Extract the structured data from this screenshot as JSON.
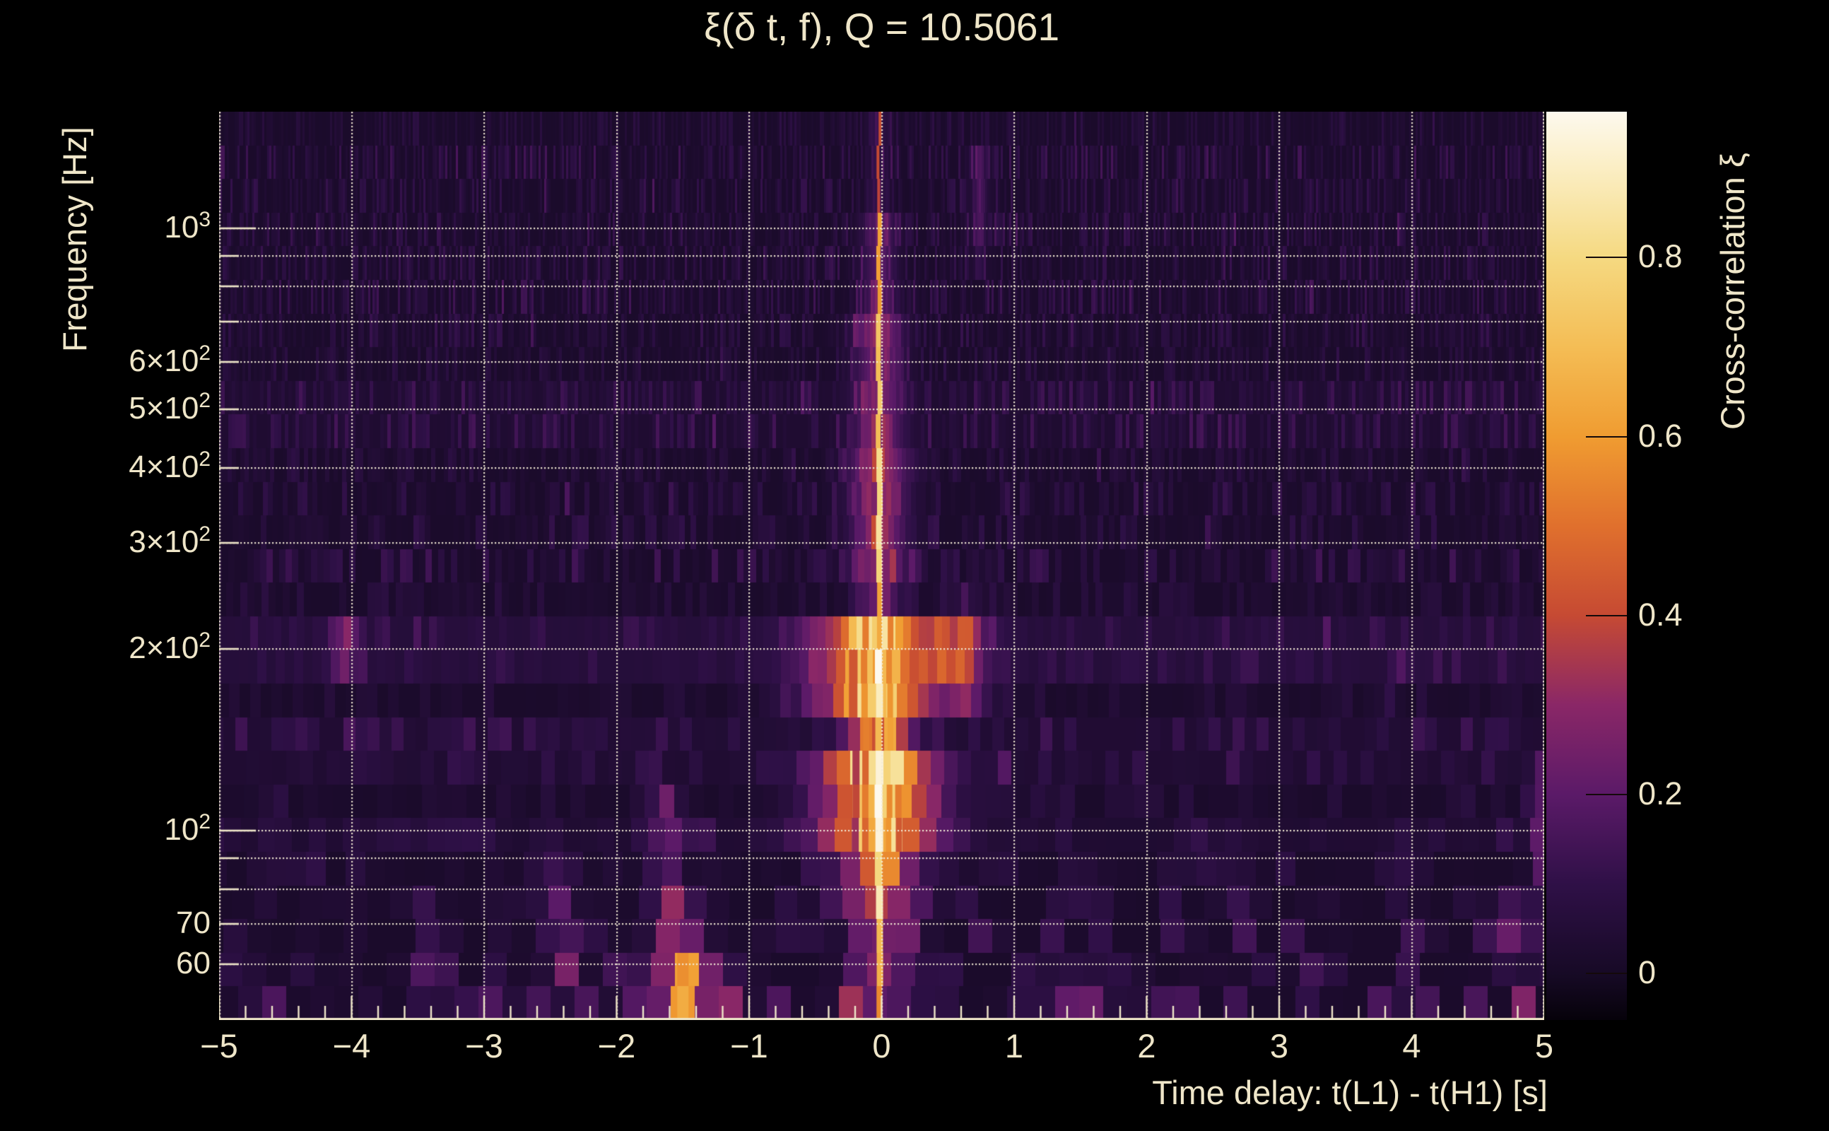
{
  "chart_data": {
    "type": "heatmap",
    "title": "ξ(δ t, f), Q = 10.5061",
    "xlabel": "Time delay: t(L1) - t(H1) [s]",
    "ylabel": "Frequency [Hz]",
    "colorbar_label": "Cross-correlation ξ",
    "x_range": [
      -5,
      5
    ],
    "x_ticks": [
      {
        "t": -5,
        "label": "−5"
      },
      {
        "t": -4,
        "label": "−4"
      },
      {
        "t": -3,
        "label": "−3"
      },
      {
        "t": -2,
        "label": "−2"
      },
      {
        "t": -1,
        "label": "−1"
      },
      {
        "t": 0,
        "label": "0"
      },
      {
        "t": 1,
        "label": "1"
      },
      {
        "t": 2,
        "label": "2"
      },
      {
        "t": 3,
        "label": "3"
      },
      {
        "t": 4,
        "label": "4"
      },
      {
        "t": 5,
        "label": "5"
      }
    ],
    "x_minor_step": 0.2,
    "y_scale": "log",
    "y_range_hz": [
      48.5,
      1560
    ],
    "y_tick_labels": [
      {
        "f": 1000,
        "base": "10",
        "sup": "3"
      },
      {
        "f": 600,
        "base": "6×10",
        "sup": "2"
      },
      {
        "f": 500,
        "base": "5×10",
        "sup": "2"
      },
      {
        "f": 400,
        "base": "4×10",
        "sup": "2"
      },
      {
        "f": 300,
        "base": "3×10",
        "sup": "2"
      },
      {
        "f": 200,
        "base": "2×10",
        "sup": "2"
      },
      {
        "f": 100,
        "base": "10",
        "sup": "2"
      },
      {
        "f": 70,
        "base": "70",
        "sup": ""
      },
      {
        "f": 60,
        "base": "60",
        "sup": ""
      }
    ],
    "y_gridlines_hz": [
      60,
      70,
      80,
      90,
      100,
      200,
      300,
      400,
      500,
      600,
      700,
      800,
      900,
      1000
    ],
    "colorbar": {
      "min": -0.052,
      "max": 0.963,
      "ticks": [
        0,
        0.2,
        0.4,
        0.6,
        0.8
      ],
      "tick_labels": [
        "0",
        "0.2",
        "0.4",
        "0.6",
        "0.8"
      ]
    },
    "colormap_anchors": [
      [
        -0.052,
        "#06020a"
      ],
      [
        0.0,
        "#170a26"
      ],
      [
        0.1,
        "#2f1047"
      ],
      [
        0.2,
        "#5b1a68"
      ],
      [
        0.3,
        "#8a2767"
      ],
      [
        0.4,
        "#c64a33"
      ],
      [
        0.5,
        "#e0702d"
      ],
      [
        0.6,
        "#f09c31"
      ],
      [
        0.7,
        "#f4bd55"
      ],
      [
        0.8,
        "#f5d981"
      ],
      [
        0.9,
        "#fbeec4"
      ],
      [
        0.963,
        "#fdf9ee"
      ]
    ],
    "grid_color": "#f2ead1",
    "axis_color": "#efe6c9",
    "signal_stripe": {
      "t": -0.02,
      "segments": [
        {
          "f": [
            1050,
            1560
          ],
          "core": 0.42,
          "coreW": 4,
          "halo": 0.08,
          "haloW": 10
        },
        {
          "f": [
            700,
            1050
          ],
          "core": 0.6,
          "coreW": 6,
          "halo": 0.16,
          "haloW": 16
        },
        {
          "f": [
            420,
            700
          ],
          "core": 0.74,
          "coreW": 7,
          "halo": 0.22,
          "haloW": 22
        },
        {
          "f": [
            260,
            420
          ],
          "core": 0.82,
          "coreW": 8,
          "halo": 0.26,
          "haloW": 26
        },
        {
          "f": [
            212,
            260
          ],
          "core": 0.62,
          "coreW": 7,
          "halo": 0.2,
          "haloW": 20
        },
        {
          "f": [
            160,
            212
          ],
          "core": 0.97,
          "coreW": 10,
          "halo": 0.45,
          "haloW": 60
        },
        {
          "f": [
            132,
            160
          ],
          "core": 0.74,
          "coreW": 9,
          "halo": 0.3,
          "haloW": 32
        },
        {
          "f": [
            92,
            132
          ],
          "core": 1.0,
          "coreW": 11,
          "halo": 0.5,
          "haloW": 55
        },
        {
          "f": [
            72,
            92
          ],
          "core": 0.86,
          "coreW": 10,
          "halo": 0.34,
          "haloW": 40
        },
        {
          "f": [
            56,
            72
          ],
          "core": 0.72,
          "coreW": 9,
          "halo": 0.24,
          "haloW": 26
        },
        {
          "f": [
            48,
            56
          ],
          "core": 0.55,
          "coreW": 8,
          "halo": 0.18,
          "haloW": 20
        }
      ],
      "satellites": [
        {
          "f": [
            88,
            215
          ],
          "dx": -20,
          "w": 9,
          "v": 0.55
        },
        {
          "f": [
            88,
            215
          ],
          "dx": 15,
          "w": 8,
          "v": 0.58
        },
        {
          "f": [
            90,
            140
          ],
          "dx": 28,
          "w": 9,
          "v": 0.48
        },
        {
          "f": [
            150,
            212
          ],
          "dx": -36,
          "w": 12,
          "v": 0.4
        },
        {
          "f": [
            95,
            130
          ],
          "dx": -32,
          "w": 10,
          "v": 0.38
        }
      ]
    },
    "features": [
      {
        "t": -1.5,
        "f": [
          47,
          63
        ],
        "w": 16,
        "v": 0.62,
        "haloW": 46,
        "halo": 0.26,
        "hard": true
      },
      {
        "t": -1.5,
        "f": [
          63,
          78
        ],
        "w": 12,
        "v": 0.22,
        "haloW": 30,
        "halo": 0.08,
        "hard": false
      },
      {
        "t": -2.42,
        "f": [
          56,
          92
        ],
        "w": 12,
        "v": 0.2,
        "haloW": 24,
        "halo": 0.06,
        "hard": false
      },
      {
        "t": -1.63,
        "f": [
          64,
          112
        ],
        "w": 10,
        "v": 0.26,
        "haloW": 22,
        "halo": 0.08,
        "hard": false
      },
      {
        "t": 0.63,
        "f": [
          168,
          232
        ],
        "w": 13,
        "v": 0.36,
        "haloW": 30,
        "halo": 0.1,
        "hard": false
      },
      {
        "t": 0.45,
        "f": [
          180,
          216
        ],
        "w": 8,
        "v": 0.24,
        "haloW": 18,
        "halo": 0.06,
        "hard": false
      },
      {
        "t": -4.05,
        "f": [
          188,
          216
        ],
        "w": 9,
        "v": 0.28,
        "haloW": 18,
        "halo": 0.06,
        "hard": false
      },
      {
        "t": 0.74,
        "f": [
          900,
          1300
        ],
        "w": 6,
        "v": 0.2,
        "haloW": 14,
        "halo": 0.05,
        "hard": false
      },
      {
        "t": 1.35,
        "f": [
          47,
          57
        ],
        "w": 14,
        "v": 0.3,
        "haloW": 26,
        "halo": 0.08,
        "hard": false
      },
      {
        "t": 2.08,
        "f": [
          47,
          55
        ],
        "w": 10,
        "v": 0.2,
        "haloW": 20,
        "halo": 0.06,
        "hard": false
      },
      {
        "t": -2.9,
        "f": [
          47,
          55
        ],
        "w": 12,
        "v": 0.22,
        "haloW": 22,
        "halo": 0.06,
        "hard": false
      },
      {
        "t": 4.78,
        "f": [
          58,
          76
        ],
        "w": 10,
        "v": 0.2,
        "haloW": 18,
        "halo": 0.06,
        "hard": false
      },
      {
        "t": 4.97,
        "f": [
          80,
          130
        ],
        "w": 8,
        "v": 0.2,
        "haloW": 14,
        "halo": 0.05,
        "hard": false
      }
    ],
    "bottom_dash_band_hz": [
      48,
      57
    ],
    "bottom_dashes": [
      [
        -4.85,
        0.3
      ],
      [
        -4.6,
        0.18
      ],
      [
        -4.3,
        0.15
      ],
      [
        -3.55,
        0.18
      ],
      [
        -3.1,
        0.15
      ],
      [
        -2.62,
        0.2
      ],
      [
        -2.2,
        0.16
      ],
      [
        -1.9,
        0.14
      ],
      [
        -1.15,
        0.22
      ],
      [
        -0.8,
        0.2
      ],
      [
        -0.5,
        0.25
      ],
      [
        -0.22,
        0.3
      ],
      [
        0.25,
        0.28
      ],
      [
        0.55,
        0.2
      ],
      [
        0.95,
        0.18
      ],
      [
        1.6,
        0.15
      ],
      [
        2.35,
        0.22
      ],
      [
        2.7,
        0.18
      ],
      [
        3.3,
        0.15
      ],
      [
        3.75,
        0.14
      ],
      [
        4.15,
        0.2
      ],
      [
        4.5,
        0.16
      ],
      [
        4.85,
        0.25
      ]
    ],
    "background_bands": [
      {
        "f": [
          185,
          232
        ],
        "add": 0.045
      },
      {
        "f": [
          128,
          152
        ],
        "add": 0.025
      },
      {
        "f": [
          94,
          104
        ],
        "add": 0.02
      },
      {
        "f": [
          440,
          560
        ],
        "add": 0.018
      }
    ],
    "noise": {
      "seed": 1337,
      "rows": 27,
      "base": 0.015,
      "amp": 0.105
    }
  }
}
